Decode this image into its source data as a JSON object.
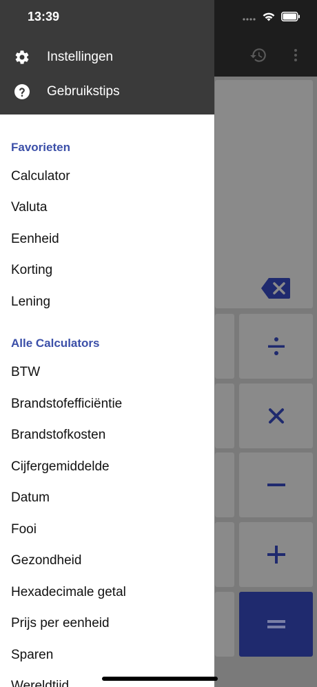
{
  "status_bar": {
    "time": "13:39"
  },
  "drawer": {
    "header_items": [
      {
        "label": "Instellingen",
        "icon": "gear-icon"
      },
      {
        "label": "Gebruikstips",
        "icon": "help-circle-icon"
      }
    ],
    "favorites_title": "Favorieten",
    "favorites": [
      "Calculator",
      "Valuta",
      "Eenheid",
      "Korting",
      "Lening"
    ],
    "all_title": "Alle Calculators",
    "all_items": [
      "BTW",
      "Brandstofefficiëntie",
      "Brandstofkosten",
      "Cijfergemiddelde",
      "Datum",
      "Fooi",
      "Gezondheid",
      "Hexadecimale getal",
      "Prijs per eenheid",
      "Sparen",
      "Wereldtijd"
    ]
  },
  "colors": {
    "accent": "#3b4fa8",
    "drawer_header": "#3a3a3a",
    "equals_key": "#1f2a6e"
  }
}
